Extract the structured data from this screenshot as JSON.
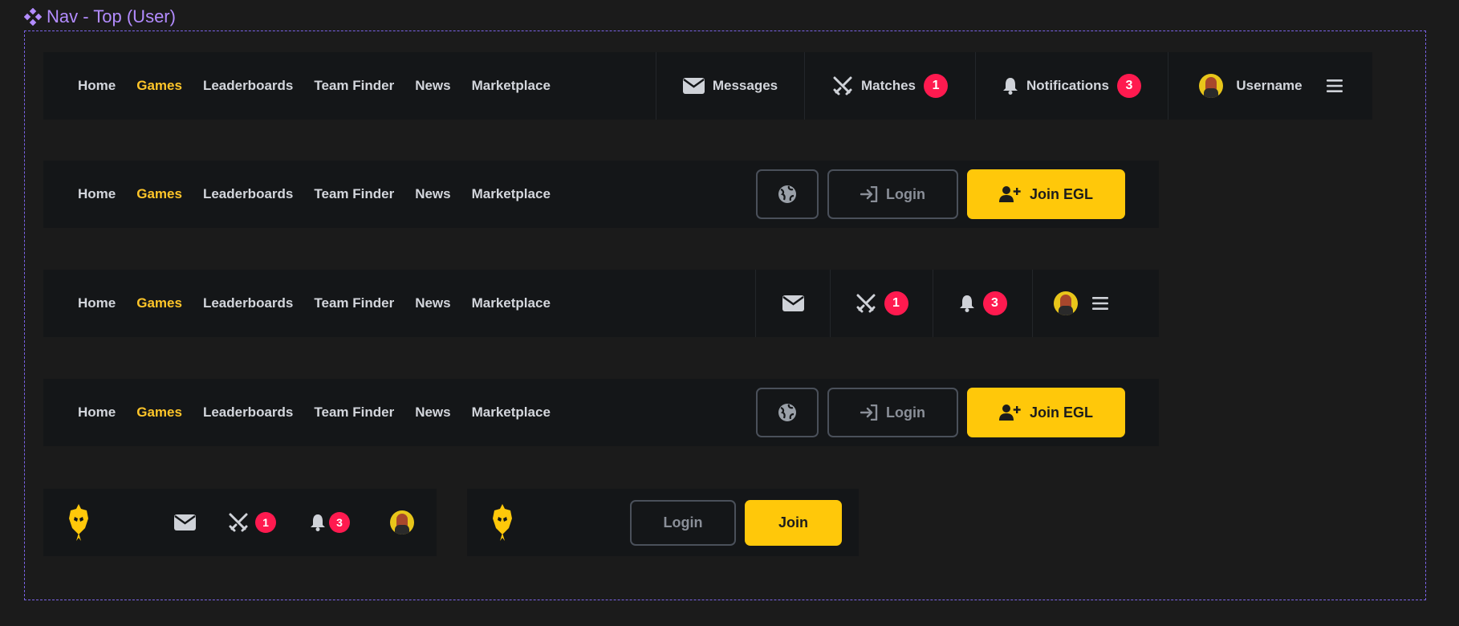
{
  "frame": {
    "title": "Nav - Top (User)"
  },
  "nav_links": [
    "Home",
    "Games",
    "Leaderboards",
    "Team Finder",
    "News",
    "Marketplace"
  ],
  "active_link": "Games",
  "user_bar": {
    "messages_label": "Messages",
    "matches_label": "Matches",
    "matches_count": "1",
    "notifications_label": "Notifications",
    "notifications_count": "3",
    "username": "Username"
  },
  "guest_bar": {
    "login_label": "Login",
    "join_label": "Join EGL"
  },
  "mobile_user": {
    "matches_count": "1",
    "notifications_count": "3"
  },
  "mobile_guest": {
    "login_label": "Login",
    "join_label": "Join"
  },
  "colors": {
    "accent": "#ffc80a",
    "badge": "#ff1a4f",
    "bar_bg": "#141618",
    "frame_border": "#7a63e6"
  }
}
